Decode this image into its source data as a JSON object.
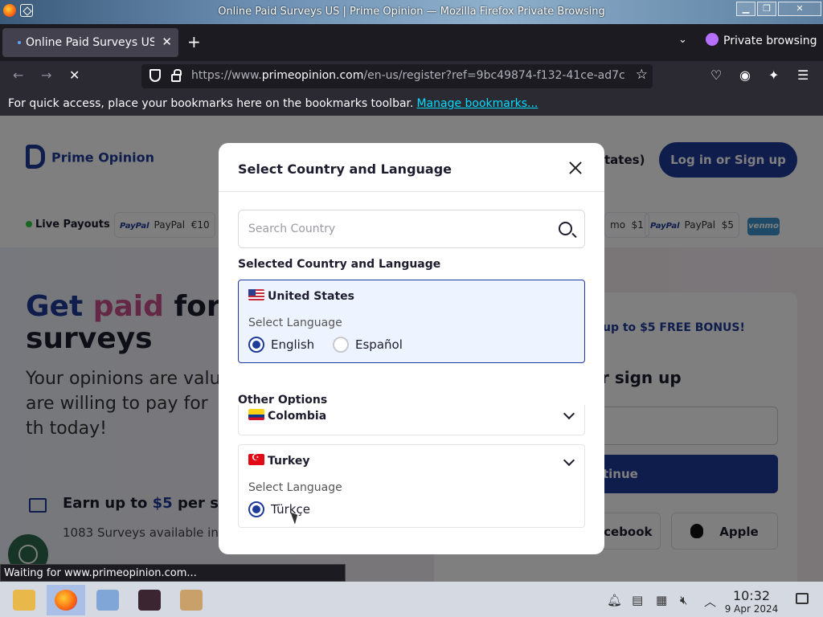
{
  "window": {
    "title": "Online Paid Surveys US | Prime Opinion — Mozilla Firefox Private Browsing"
  },
  "tabs": [
    {
      "title": "Online Paid Surveys US |"
    }
  ],
  "private_label": "Private browsing",
  "urlbar": {
    "host_prefix": "https://www.",
    "host": "primeopinion.com",
    "path": "/en-us/register?ref=9bc49874-f132-41ce-ad7c"
  },
  "bookmarks": {
    "message": "For quick access, place your bookmarks here on the bookmarks toolbar.",
    "link": "Manage bookmarks..."
  },
  "site": {
    "brand": "Prime Opinion",
    "header_partial": "tates)",
    "login_button": "Log in or Sign up",
    "live_payouts": "Live Payouts",
    "payout_chips": [
      {
        "brand": "PayPal",
        "label": "PayPal",
        "amount": "€10"
      },
      {
        "brand": "",
        "label": "mo",
        "amount": "$1"
      },
      {
        "brand": "PayPal",
        "label": "PayPal",
        "amount": "$5"
      }
    ],
    "venmo": "venmo",
    "hero": {
      "w1": "Get",
      "w2": "paid",
      "w3": "for t",
      "line2": "surveys"
    },
    "subtitle": "Your opinions are valu are willing to pay for th today!",
    "earn": {
      "prefix": "Earn up to",
      "amount": "$5",
      "suffix": "per sur"
    },
    "available": "1083 Surveys available in",
    "bonus": {
      "prefix": "up to",
      "amount": "$5 FREE BONUS!"
    },
    "or_sign_up": "r sign up",
    "continue": "tinue",
    "facebook": "acebook",
    "apple": "Apple"
  },
  "modal": {
    "title": "Select Country and Language",
    "search_placeholder": "Search Country",
    "selected_heading": "Selected Country and Language",
    "selected": {
      "country": "United States",
      "lang_label": "Select Language",
      "options": [
        {
          "label": "English",
          "checked": true
        },
        {
          "label": "Español",
          "checked": false
        }
      ]
    },
    "other_heading": "Other Options",
    "other": [
      {
        "country": "Colombia"
      },
      {
        "country": "Turkey",
        "lang_label": "Select Language",
        "options": [
          {
            "label": "Türkçe",
            "checked": true
          }
        ]
      }
    ]
  },
  "status_text": "Waiting for www.primeopinion.com...",
  "taskbar": {
    "time": "10:32",
    "date": "9 Apr 2024"
  },
  "colors": {
    "brand_blue": "#1f3b9a",
    "modal_selected_bg": "#eef4ff"
  }
}
